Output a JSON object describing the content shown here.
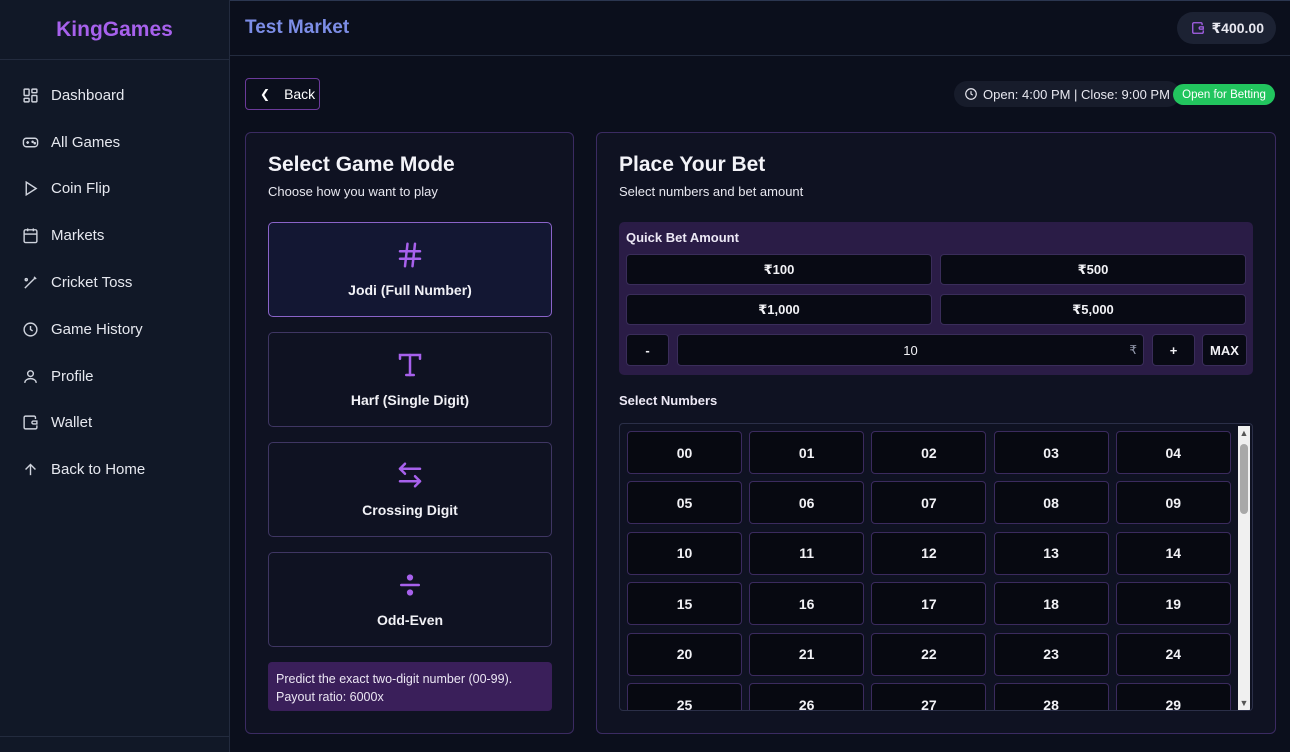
{
  "app": {
    "brand": "KingGames",
    "page_title": "Test Market",
    "wallet_balance": "₹400.00"
  },
  "sidebar": {
    "items": [
      {
        "label": "Dashboard",
        "icon": "dashboard-icon"
      },
      {
        "label": "All Games",
        "icon": "gamepad-icon"
      },
      {
        "label": "Coin Flip",
        "icon": "play-icon"
      },
      {
        "label": "Markets",
        "icon": "calendar-icon"
      },
      {
        "label": "Cricket Toss",
        "icon": "bat-icon"
      },
      {
        "label": "Game History",
        "icon": "clock-icon"
      },
      {
        "label": "Profile",
        "icon": "user-icon"
      },
      {
        "label": "Wallet",
        "icon": "wallet-icon"
      },
      {
        "label": "Back to Home",
        "icon": "arrow-up-icon"
      }
    ]
  },
  "header": {
    "back_label": "Back",
    "timing": "Open: 4:00 PM | Close: 9:00 PM",
    "status": "Open for Betting"
  },
  "mode_panel": {
    "title": "Select Game Mode",
    "subtitle": "Choose how you want to play",
    "modes": [
      {
        "label": "Jodi (Full Number)",
        "icon": "hash-icon",
        "active": true
      },
      {
        "label": "Harf (Single Digit)",
        "icon": "text-t-icon",
        "active": false
      },
      {
        "label": "Crossing Digit",
        "icon": "swap-arrows-icon",
        "active": false
      },
      {
        "label": "Odd-Even",
        "icon": "divide-icon",
        "active": false
      }
    ],
    "description_line1": "Predict the exact two-digit number (00-99).",
    "description_line2": "Payout ratio: 6000x"
  },
  "bet_panel": {
    "title": "Place Your Bet",
    "subtitle": "Select numbers and bet amount",
    "quick_label": "Quick Bet Amount",
    "quick_amounts": [
      "₹100",
      "₹500",
      "₹1,000",
      "₹5,000"
    ],
    "minus_label": "-",
    "amount_value": "10",
    "currency_symbol": "₹",
    "plus_label": "+",
    "max_label": "MAX",
    "numbers_label": "Select Numbers",
    "numbers": [
      "00",
      "01",
      "02",
      "03",
      "04",
      "05",
      "06",
      "07",
      "08",
      "09",
      "10",
      "11",
      "12",
      "13",
      "14",
      "15",
      "16",
      "17",
      "18",
      "19",
      "20",
      "21",
      "22",
      "23",
      "24",
      "25",
      "26",
      "27",
      "28",
      "29"
    ]
  },
  "colors": {
    "accent": "#a761ec",
    "brand_title": "#7c8de6",
    "status_green": "#22c55e",
    "background": "#0b0f1c"
  }
}
